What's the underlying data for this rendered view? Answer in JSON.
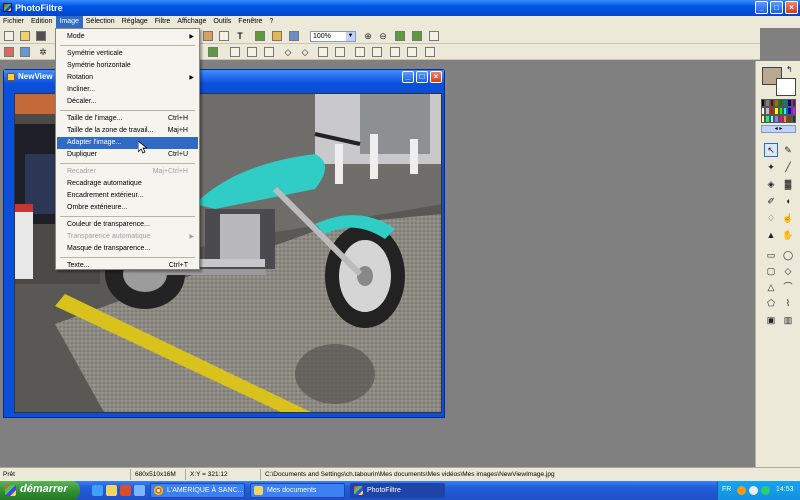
{
  "app": {
    "title": "PhotoFiltre"
  },
  "window_controls": {
    "minimize": "_",
    "maximize": "□",
    "close": "×"
  },
  "menubar": [
    "Fichier",
    "Edition",
    "Image",
    "Sélection",
    "Réglage",
    "Filtre",
    "Affichage",
    "Outils",
    "Fenêtre",
    "?"
  ],
  "toolbar": {
    "zoom": "100%",
    "zoom_arrow": "▼"
  },
  "image_window": {
    "title": "NewView"
  },
  "image_menu": {
    "items": [
      {
        "label": "Mode",
        "shortcut": "",
        "submenu": true,
        "disabled": false
      },
      {
        "sep": true
      },
      {
        "label": "Symétrie verticale",
        "shortcut": "",
        "submenu": false,
        "disabled": false
      },
      {
        "label": "Symétrie horizontale",
        "shortcut": "",
        "submenu": false,
        "disabled": false
      },
      {
        "label": "Rotation",
        "shortcut": "",
        "submenu": true,
        "disabled": false
      },
      {
        "label": "Incliner...",
        "shortcut": "",
        "submenu": false,
        "disabled": false
      },
      {
        "label": "Décaler...",
        "shortcut": "",
        "submenu": false,
        "disabled": false
      },
      {
        "sep": true
      },
      {
        "label": "Taille de l'image...",
        "shortcut": "Ctrl+H",
        "submenu": false,
        "disabled": false
      },
      {
        "label": "Taille de la zone de travail...",
        "shortcut": "Maj+H",
        "submenu": false,
        "disabled": false
      },
      {
        "label": "Adapter l'image...",
        "shortcut": "",
        "submenu": false,
        "disabled": false,
        "highlighted": true
      },
      {
        "label": "Dupliquer",
        "shortcut": "Ctrl+U",
        "submenu": false,
        "disabled": false
      },
      {
        "sep": true
      },
      {
        "label": "Recadrer",
        "shortcut": "Maj+Ctrl+H",
        "submenu": false,
        "disabled": true
      },
      {
        "label": "Recadrage automatique",
        "shortcut": "",
        "submenu": false,
        "disabled": false
      },
      {
        "label": "Encadrement extérieur...",
        "shortcut": "",
        "submenu": false,
        "disabled": false
      },
      {
        "label": "Ombre extérieure...",
        "shortcut": "",
        "submenu": false,
        "disabled": false
      },
      {
        "sep": true
      },
      {
        "label": "Couleur de transparence...",
        "shortcut": "",
        "submenu": false,
        "disabled": false
      },
      {
        "label": "Transparence automatique",
        "shortcut": "",
        "submenu": true,
        "disabled": true
      },
      {
        "label": "Masque de transparence...",
        "shortcut": "",
        "submenu": false,
        "disabled": false
      },
      {
        "sep": true
      },
      {
        "label": "Texte...",
        "shortcut": "Ctrl+T",
        "submenu": false,
        "disabled": false
      }
    ]
  },
  "palette": {
    "fg_color": "#b8a890",
    "bg_color": "#ffffff",
    "swap": "↰",
    "nav": "◂ ▸",
    "colors": [
      "#000000",
      "#808080",
      "#800000",
      "#808000",
      "#008000",
      "#008080",
      "#000080",
      "#800080",
      "#ffffff",
      "#c0c0c0",
      "#ff0000",
      "#ffff00",
      "#00ff00",
      "#00ffff",
      "#0000ff",
      "#ff00ff",
      "#ffff80",
      "#00ff80",
      "#80ffff",
      "#8080ff",
      "#ff0080",
      "#ff8040",
      "#804000",
      "#004040"
    ]
  },
  "statusbar": {
    "status": "Prêt",
    "dimensions": "680x510x16M",
    "coords": "X:Y = 321:12",
    "path": "C:\\Documents and Settings\\ch.tabourin\\Mes documents\\Mes vidéos\\Mes images\\NewViewImage.jpg"
  },
  "taskbar": {
    "start": "démarrer",
    "tasks": [
      "L'AMERIQUE À SANC...",
      "Mes documents",
      "PhotoFiltre"
    ],
    "lang": "FR",
    "time": "14:53"
  },
  "icons": {
    "text_tool": "T",
    "zoom_in": "⊕",
    "zoom_out": "⊖",
    "pointer": "↖",
    "eyedropper": "✎",
    "wand": "✦",
    "line": "╱",
    "bucket": "◈",
    "spray": "▓",
    "brush": "✐",
    "blur": "◖",
    "drop": "♢",
    "smudge": "☝",
    "stamp": "▲",
    "hand": "✋",
    "rect": "▭",
    "ellipse": "◯",
    "roundrect": "▢",
    "diamond": "◇",
    "triangle": "△",
    "lasso": "⌒",
    "polygon": "⬠",
    "bezier": "⌇"
  }
}
